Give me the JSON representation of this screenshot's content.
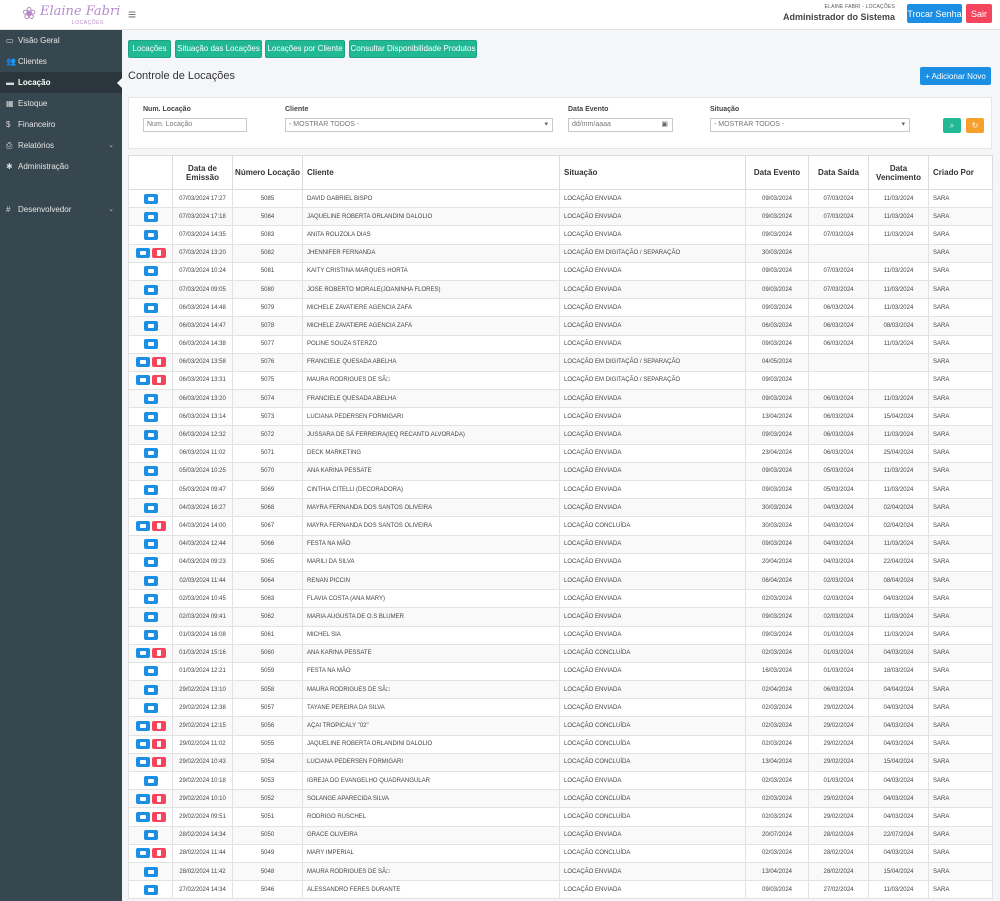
{
  "header": {
    "logo_text": "Elaine Fabri",
    "logo_sub": "LOCAÇÕES",
    "company": "ELAINE FABRI - LOCAÇÕES",
    "user_role": "Administrador do Sistema",
    "change_password": "Trocar Senha",
    "logout": "Sair"
  },
  "sidebar": {
    "items": [
      {
        "label": "Visão Geral",
        "icon": "monitor-icon"
      },
      {
        "label": "Clientes",
        "icon": "users-icon"
      },
      {
        "label": "Locação",
        "icon": "box-icon"
      },
      {
        "label": "Estoque",
        "icon": "grid-icon"
      },
      {
        "label": "Financeiro",
        "icon": "dollar-icon"
      },
      {
        "label": "Relatórios",
        "icon": "printer-icon"
      },
      {
        "label": "Administração",
        "icon": "gear-icon"
      }
    ],
    "dev_label": "Desenvolvedor"
  },
  "tabs": [
    "Locações",
    "Situação das Locações",
    "Locações por Cliente",
    "Consultar Disponibilidade Produtos"
  ],
  "page_title": "Controle de Locações",
  "add_button": "+ Adicionar Novo",
  "filters": {
    "num_label": "Num. Locação",
    "num_placeholder": "Num. Locação",
    "cliente_label": "Cliente",
    "cliente_value": "- MOSTRAR TODOS -",
    "data_label": "Data Evento",
    "data_value": "dd/mm/aaaa",
    "situacao_label": "Situação",
    "situacao_value": "- MOSTRAR TODOS -"
  },
  "table": {
    "headers": [
      "",
      "Data de Emissão",
      "Número Locação",
      "Cliente",
      "Situação",
      "Data Evento",
      "Data Saída",
      "Data Vencimento",
      "Criado Por"
    ],
    "rows": [
      {
        "a": 1,
        "e": "07/03/2024 17:27",
        "n": "5085",
        "c": "DAVID GABRIEL BISPO",
        "s": "LOCAÇÃO ENVIADA",
        "ev": "09/03/2024",
        "sa": "07/03/2024",
        "ve": "11/03/2024",
        "cr": "SARA"
      },
      {
        "a": 1,
        "e": "07/03/2024 17:18",
        "n": "5084",
        "c": "JAQUELINE ROBERTA ORLANDINI DALOLIO",
        "s": "LOCAÇÃO ENVIADA",
        "ev": "09/03/2024",
        "sa": "07/03/2024",
        "ve": "11/03/2024",
        "cr": "SARA"
      },
      {
        "a": 1,
        "e": "07/03/2024 14:35",
        "n": "5083",
        "c": "ANITA ROLIZOLA DIAS",
        "s": "LOCAÇÃO ENVIADA",
        "ev": "09/03/2024",
        "sa": "07/03/2024",
        "ve": "11/03/2024",
        "cr": "SARA"
      },
      {
        "a": 2,
        "e": "07/03/2024 13:20",
        "n": "5082",
        "c": "JHENNIFER FERNANDA",
        "s": "LOCAÇÃO EM DIGITAÇÃO / SEPARAÇÃO",
        "ev": "30/03/2024",
        "sa": "",
        "ve": "",
        "cr": "SARA"
      },
      {
        "a": 1,
        "e": "07/03/2024 10:24",
        "n": "5081",
        "c": "KAITY CRISTINA MARQUES HORTA",
        "s": "LOCAÇÃO ENVIADA",
        "ev": "09/03/2024",
        "sa": "07/03/2024",
        "ve": "11/03/2024",
        "cr": "SARA"
      },
      {
        "a": 1,
        "e": "07/03/2024 09:05",
        "n": "5080",
        "c": "JOSE ROBERTO MORALE(JOANINHA FLORES)",
        "s": "LOCAÇÃO ENVIADA",
        "ev": "09/03/2024",
        "sa": "07/03/2024",
        "ve": "11/03/2024",
        "cr": "SARA"
      },
      {
        "a": 1,
        "e": "06/03/2024 14:48",
        "n": "5079",
        "c": "MICHELE ZAVATIERE AGENCIA ZAFA",
        "s": "LOCAÇÃO ENVIADA",
        "ev": "09/03/2024",
        "sa": "06/03/2024",
        "ve": "11/03/2024",
        "cr": "SARA"
      },
      {
        "a": 1,
        "e": "06/03/2024 14:47",
        "n": "5078",
        "c": "MICHELE ZAVATIERE AGENCIA ZAFA",
        "s": "LOCAÇÃO ENVIADA",
        "ev": "06/03/2024",
        "sa": "06/03/2024",
        "ve": "08/03/2024",
        "cr": "SARA"
      },
      {
        "a": 1,
        "e": "06/03/2024 14:38",
        "n": "5077",
        "c": "POLINE SOUZA STERZO",
        "s": "LOCAÇÃO ENVIADA",
        "ev": "09/03/2024",
        "sa": "06/03/2024",
        "ve": "11/03/2024",
        "cr": "SARA"
      },
      {
        "a": 2,
        "e": "06/03/2024 13:58",
        "n": "5076",
        "c": "FRANCIELE QUESADA ABELHA",
        "s": "LOCAÇÃO EM DIGITAÇÃO / SEPARAÇÃO",
        "ev": "04/05/2024",
        "sa": "",
        "ve": "",
        "cr": "SARA"
      },
      {
        "a": 2,
        "e": "06/03/2024 13:31",
        "n": "5075",
        "c": "MAURA RODRIGUES DE SÃ□",
        "s": "LOCAÇÃO EM DIGITAÇÃO / SEPARAÇÃO",
        "ev": "09/03/2024",
        "sa": "",
        "ve": "",
        "cr": "SARA"
      },
      {
        "a": 1,
        "e": "06/03/2024 13:20",
        "n": "5074",
        "c": "FRANCIELE QUESADA ABELHA",
        "s": "LOCAÇÃO ENVIADA",
        "ev": "09/03/2024",
        "sa": "06/03/2024",
        "ve": "11/03/2024",
        "cr": "SARA"
      },
      {
        "a": 1,
        "e": "06/03/2024 13:14",
        "n": "5073",
        "c": "LUCIANA PEDERSEN FORMIGARI",
        "s": "LOCAÇÃO ENVIADA",
        "ev": "13/04/2024",
        "sa": "06/03/2024",
        "ve": "15/04/2024",
        "cr": "SARA"
      },
      {
        "a": 1,
        "e": "06/03/2024 12:32",
        "n": "5072",
        "c": "JUSSARA DE SÁ FERREIRA(IEQ RECANTO ALVORADA)",
        "s": "LOCAÇÃO ENVIADA",
        "ev": "09/03/2024",
        "sa": "06/03/2024",
        "ve": "11/03/2024",
        "cr": "SARA"
      },
      {
        "a": 1,
        "e": "06/03/2024 11:02",
        "n": "5071",
        "c": "DECK MARKETING",
        "s": "LOCAÇÃO ENVIADA",
        "ev": "23/04/2024",
        "sa": "06/03/2024",
        "ve": "25/04/2024",
        "cr": "SARA"
      },
      {
        "a": 1,
        "e": "05/03/2024 10:25",
        "n": "5070",
        "c": "ANA KARINA PESSATE",
        "s": "LOCAÇÃO ENVIADA",
        "ev": "09/03/2024",
        "sa": "05/03/2024",
        "ve": "11/03/2024",
        "cr": "SARA"
      },
      {
        "a": 1,
        "e": "05/03/2024 09:47",
        "n": "5069",
        "c": "CINTHIA CITELLI (DECORADORA)",
        "s": "LOCAÇÃO ENVIADA",
        "ev": "09/03/2024",
        "sa": "05/03/2024",
        "ve": "11/03/2024",
        "cr": "SARA"
      },
      {
        "a": 1,
        "e": "04/03/2024 16:27",
        "n": "5068",
        "c": "MAYRA FERNANDA DOS SANTOS OLIVEIRA",
        "s": "LOCAÇÃO ENVIADA",
        "ev": "30/03/2024",
        "sa": "04/03/2024",
        "ve": "02/04/2024",
        "cr": "SARA"
      },
      {
        "a": 2,
        "e": "04/03/2024 14:00",
        "n": "5067",
        "c": "MAYRA FERNANDA DOS SANTOS OLIVEIRA",
        "s": "LOCAÇÃO CONCLUÍDA",
        "ev": "30/03/2024",
        "sa": "04/03/2024",
        "ve": "02/04/2024",
        "cr": "SARA"
      },
      {
        "a": 1,
        "e": "04/03/2024 12:44",
        "n": "5066",
        "c": "FESTA NA MÃO",
        "s": "LOCAÇÃO ENVIADA",
        "ev": "09/03/2024",
        "sa": "04/03/2024",
        "ve": "11/03/2024",
        "cr": "SARA"
      },
      {
        "a": 1,
        "e": "04/03/2024 09:23",
        "n": "5065",
        "c": "MARILI DA SILVA",
        "s": "LOCAÇÃO ENVIADA",
        "ev": "20/04/2024",
        "sa": "04/03/2024",
        "ve": "22/04/2024",
        "cr": "SARA"
      },
      {
        "a": 1,
        "e": "02/03/2024 11:44",
        "n": "5064",
        "c": "RENAN PICCIN",
        "s": "LOCAÇÃO ENVIADA",
        "ev": "06/04/2024",
        "sa": "02/03/2024",
        "ve": "08/04/2024",
        "cr": "SARA"
      },
      {
        "a": 1,
        "e": "02/03/2024 10:45",
        "n": "5063",
        "c": "FLAVIA COSTA (ANA MARY)",
        "s": "LOCAÇÃO ENVIADA",
        "ev": "02/03/2024",
        "sa": "02/03/2024",
        "ve": "04/03/2024",
        "cr": "SARA"
      },
      {
        "a": 1,
        "e": "02/03/2024 09:41",
        "n": "5062",
        "c": "MARIA AUGUSTA DE O.S BLUMER",
        "s": "LOCAÇÃO ENVIADA",
        "ev": "09/03/2024",
        "sa": "02/03/2024",
        "ve": "11/03/2024",
        "cr": "SARA"
      },
      {
        "a": 1,
        "e": "01/03/2024 16:08",
        "n": "5061",
        "c": "MICHEL SIA",
        "s": "LOCAÇÃO ENVIADA",
        "ev": "09/03/2024",
        "sa": "01/03/2024",
        "ve": "11/03/2024",
        "cr": "SARA"
      },
      {
        "a": 2,
        "e": "01/03/2024 15:16",
        "n": "5060",
        "c": "ANA KARINA PESSATE",
        "s": "LOCAÇÃO CONCLUÍDA",
        "ev": "02/03/2024",
        "sa": "01/03/2024",
        "ve": "04/03/2024",
        "cr": "SARA"
      },
      {
        "a": 1,
        "e": "01/03/2024 12:21",
        "n": "5059",
        "c": "FESTA NA MÃO",
        "s": "LOCAÇÃO ENVIADA",
        "ev": "16/03/2024",
        "sa": "01/03/2024",
        "ve": "18/03/2024",
        "cr": "SARA"
      },
      {
        "a": 1,
        "e": "29/02/2024 13:10",
        "n": "5058",
        "c": "MAURA RODRIGUES DE SÃ□",
        "s": "LOCAÇÃO ENVIADA",
        "ev": "02/04/2024",
        "sa": "06/03/2024",
        "ve": "04/04/2024",
        "cr": "SARA"
      },
      {
        "a": 1,
        "e": "29/02/2024 12:38",
        "n": "5057",
        "c": "TAYANE PEREIRA DA SILVA",
        "s": "LOCAÇÃO ENVIADA",
        "ev": "02/03/2024",
        "sa": "29/02/2024",
        "ve": "04/03/2024",
        "cr": "SARA"
      },
      {
        "a": 2,
        "e": "29/02/2024 12:15",
        "n": "5056",
        "c": "AÇAI TROPICALY \"02\"",
        "s": "LOCAÇÃO CONCLUÍDA",
        "ev": "02/03/2024",
        "sa": "29/02/2024",
        "ve": "04/03/2024",
        "cr": "SARA"
      },
      {
        "a": 2,
        "e": "29/02/2024 11:02",
        "n": "5055",
        "c": "JAQUELINE ROBERTA ORLANDINI DALOLIO",
        "s": "LOCAÇÃO CONCLUÍDA",
        "ev": "02/03/2024",
        "sa": "29/02/2024",
        "ve": "04/03/2024",
        "cr": "SARA"
      },
      {
        "a": 2,
        "e": "29/02/2024 10:43",
        "n": "5054",
        "c": "LUCIANA PEDERSEN FORMIGARI",
        "s": "LOCAÇÃO CONCLUÍDA",
        "ev": "13/04/2024",
        "sa": "29/02/2024",
        "ve": "15/04/2024",
        "cr": "SARA"
      },
      {
        "a": 1,
        "e": "29/02/2024 10:18",
        "n": "5053",
        "c": "IGREJA DO EVANGELHO QUADRANGULAR",
        "s": "LOCAÇÃO ENVIADA",
        "ev": "02/03/2024",
        "sa": "01/03/2024",
        "ve": "04/03/2024",
        "cr": "SARA"
      },
      {
        "a": 2,
        "e": "29/02/2024 10:10",
        "n": "5052",
        "c": "SOLANGE APARECIDA SILVA",
        "s": "LOCAÇÃO CONCLUÍDA",
        "ev": "02/03/2024",
        "sa": "29/02/2024",
        "ve": "04/03/2024",
        "cr": "SARA"
      },
      {
        "a": 2,
        "e": "29/02/2024 09:51",
        "n": "5051",
        "c": "RODRIGO RUSCHEL",
        "s": "LOCAÇÃO CONCLUÍDA",
        "ev": "02/03/2024",
        "sa": "29/02/2024",
        "ve": "04/03/2024",
        "cr": "SARA"
      },
      {
        "a": 1,
        "e": "28/02/2024 14:34",
        "n": "5050",
        "c": "GRACE OLIVEIRA",
        "s": "LOCAÇÃO ENVIADA",
        "ev": "20/07/2024",
        "sa": "28/02/2024",
        "ve": "22/07/2024",
        "cr": "SARA"
      },
      {
        "a": 2,
        "e": "28/02/2024 11:44",
        "n": "5049",
        "c": "MARY IMPERIAL",
        "s": "LOCAÇÃO CONCLUÍDA",
        "ev": "02/03/2024",
        "sa": "28/02/2024",
        "ve": "04/03/2024",
        "cr": "SARA"
      },
      {
        "a": 1,
        "e": "28/02/2024 11:42",
        "n": "5048",
        "c": "MAURA RODRIGUES DE SÃ□",
        "s": "LOCAÇÃO ENVIADA",
        "ev": "13/04/2024",
        "sa": "28/02/2024",
        "ve": "15/04/2024",
        "cr": "SARA"
      },
      {
        "a": 1,
        "e": "27/02/2024 14:34",
        "n": "5046",
        "c": "ALESSANDRO FERES DURANTE",
        "s": "LOCAÇÃO ENVIADA",
        "ev": "09/03/2024",
        "sa": "27/02/2024",
        "ve": "11/03/2024",
        "cr": "SARA"
      }
    ]
  },
  "colors": {
    "primary": "#1a8fe3",
    "success": "#21b894",
    "danger": "#f5455c",
    "warning": "#f7a02b",
    "sidebar": "#37474f"
  }
}
